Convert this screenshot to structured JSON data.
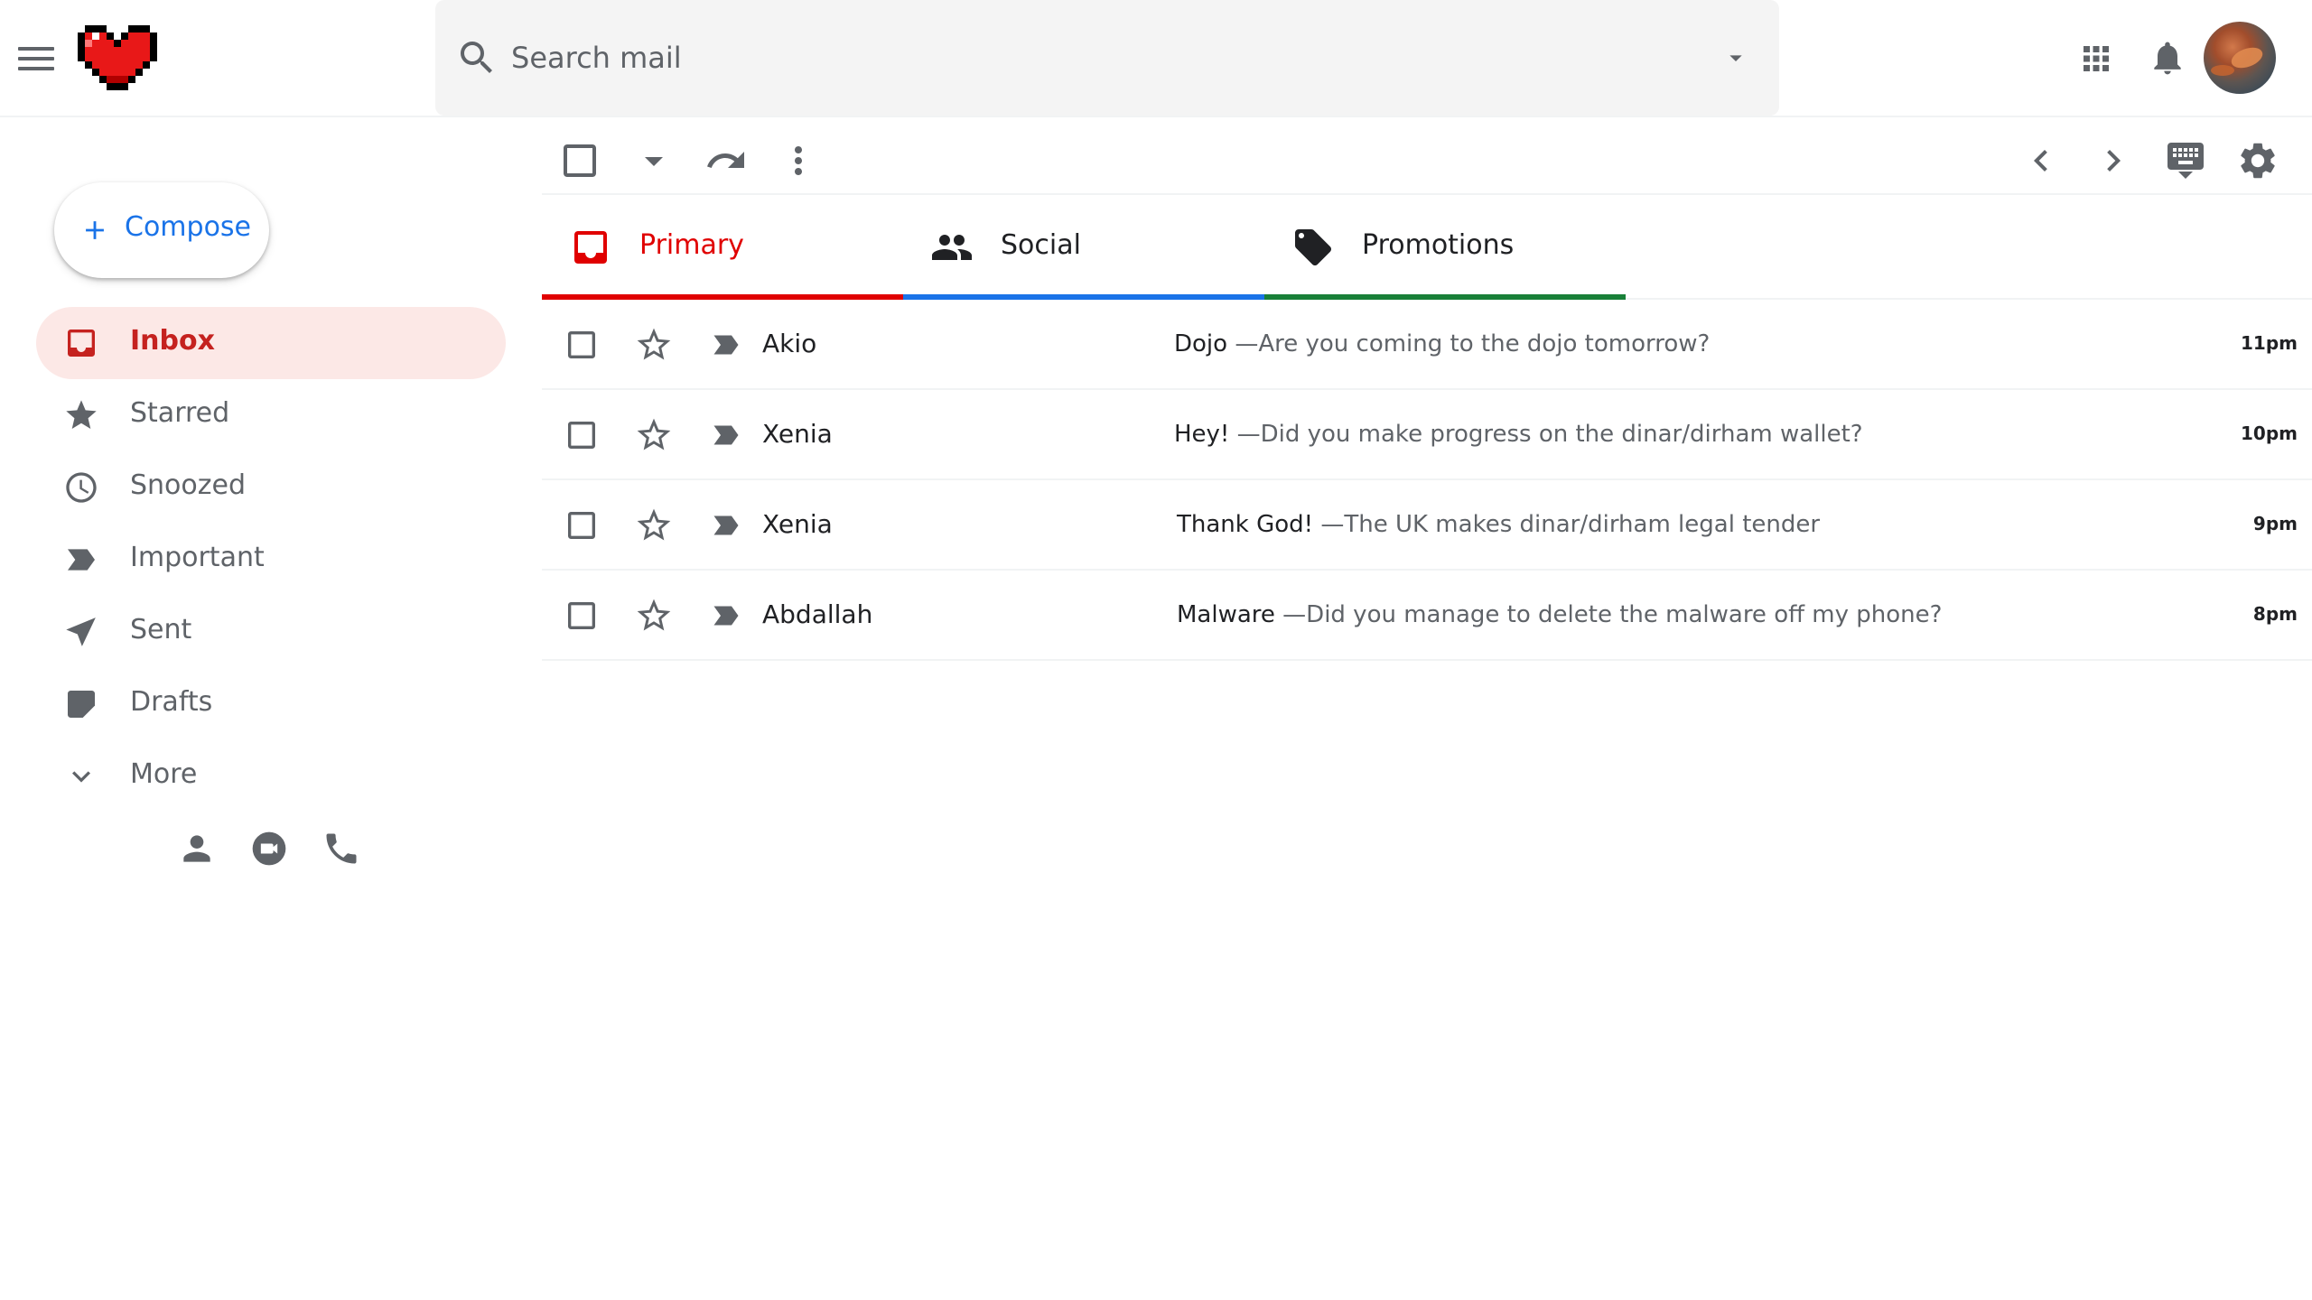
{
  "header": {
    "search_placeholder": "Search mail"
  },
  "sidebar": {
    "compose_label": "Compose",
    "items": [
      {
        "label": "Inbox",
        "icon": "inbox-icon",
        "active": true
      },
      {
        "label": "Starred",
        "icon": "star-icon"
      },
      {
        "label": "Snoozed",
        "icon": "clock-icon"
      },
      {
        "label": "Important",
        "icon": "important-icon"
      },
      {
        "label": "Sent",
        "icon": "send-icon"
      },
      {
        "label": "Drafts",
        "icon": "draft-icon"
      },
      {
        "label": "More",
        "icon": "chevron-down-icon"
      }
    ],
    "contact_icons": [
      "person-icon",
      "video-call-icon",
      "phone-icon"
    ]
  },
  "tabs": [
    {
      "label": "Primary",
      "icon": "inbox-icon",
      "color": "#e00000",
      "active": true
    },
    {
      "label": "Social",
      "icon": "people-icon",
      "color": "#1a73e8"
    },
    {
      "label": "Promotions",
      "icon": "tag-icon",
      "color": "#188038"
    }
  ],
  "emails": [
    {
      "sender": "Akio",
      "subject": "Dojo",
      "snippet": "—Are you coming to the dojo tomorrow?",
      "time": "11pm"
    },
    {
      "sender": "Xenia",
      "subject": "Hey!",
      "snippet": "—Did you make progress on the dinar/dirham wallet?",
      "time": "10pm"
    },
    {
      "sender": "Xenia",
      "subject": "Thank God!",
      "snippet": "—The UK makes dinar/dirham legal tender",
      "time": "9pm"
    },
    {
      "sender": "Abdallah",
      "subject": "Malware",
      "snippet": "—Did you manage to delete the malware off my phone?",
      "time": "8pm"
    }
  ],
  "colors": {
    "accent_red": "#c5221f",
    "active_bg": "#fce8e6",
    "compose_blue": "#1a73e8",
    "icon_gray": "#5f6368"
  }
}
